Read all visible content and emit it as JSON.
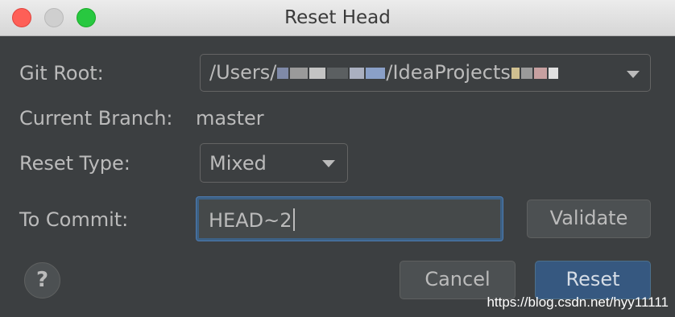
{
  "window": {
    "title": "Reset Head",
    "controls": [
      "close",
      "minimize",
      "maximize"
    ]
  },
  "form": {
    "git_root_label": "Git Root:",
    "git_root_value_prefix": "/Users/",
    "git_root_value_middle": "/IdeaProjects",
    "current_branch_label": "Current Branch:",
    "current_branch_value": "master",
    "reset_type_label": "Reset Type:",
    "reset_type_value": "Mixed",
    "to_commit_label": "To Commit:",
    "to_commit_value": "HEAD~2"
  },
  "buttons": {
    "validate": "Validate",
    "cancel": "Cancel",
    "reset": "Reset",
    "help": "?"
  },
  "watermark": "https://blog.csdn.net/hyy11111",
  "colors": {
    "background": "#3c3f41",
    "text": "#bbbbbb",
    "primary_button": "#365880",
    "focus_border": "#4c7bb3"
  }
}
